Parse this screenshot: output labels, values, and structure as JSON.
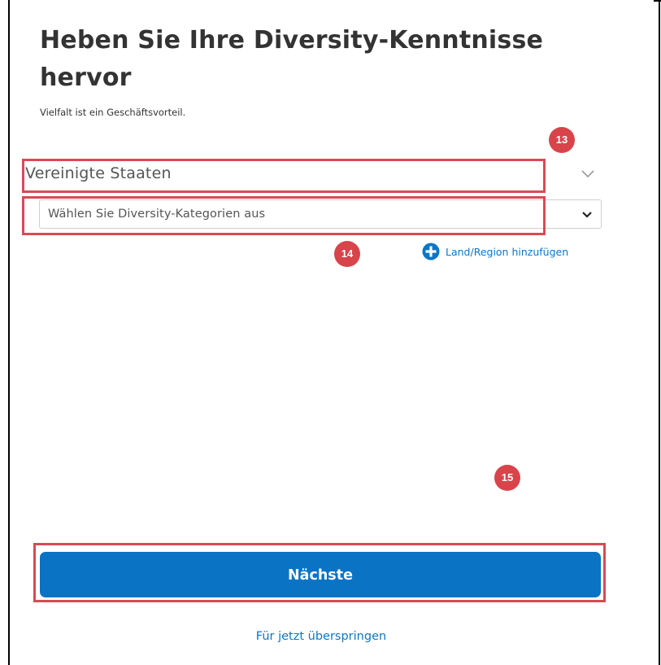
{
  "page": {
    "title": "Heben Sie Ihre Diversity-Kenntnisse hervor",
    "subtitle": "Vielfalt ist ein Geschäftsvorteil."
  },
  "form": {
    "country_value": "Vereinigte Staaten",
    "category_placeholder": "Wählen Sie Diversity-Kategorien aus",
    "add_region_label": "Land/Region hinzufügen",
    "next_label": "Nächste",
    "skip_label": "Für jetzt überspringen"
  },
  "annotations": {
    "badge_13": "13",
    "badge_14": "14",
    "badge_15": "15"
  },
  "icons": {
    "country_chevron": "chevron-down-icon",
    "category_chevron": "chevron-down-icon",
    "add": "plus-circle-icon"
  },
  "colors": {
    "accent": "#0b73c4",
    "link": "#0b76c5",
    "annotation_red": "#d94a54",
    "text": "#333333"
  }
}
